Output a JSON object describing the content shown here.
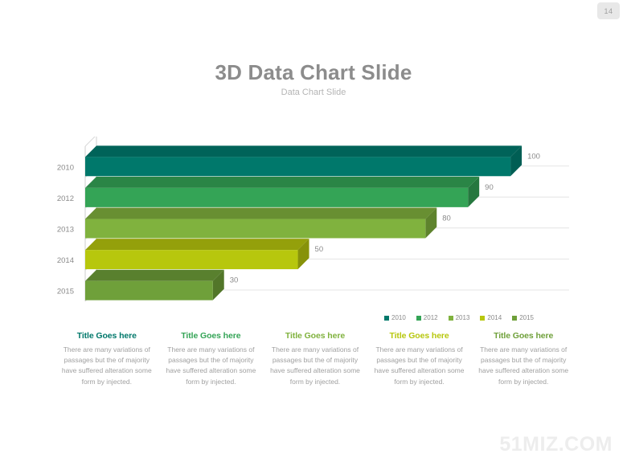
{
  "page": {
    "number": "14"
  },
  "header": {
    "title": "3D Data Chart Slide",
    "subtitle": "Data Chart Slide"
  },
  "watermark": {
    "text": "51MIZ.COM"
  },
  "chart_data": {
    "type": "bar",
    "orientation": "horizontal",
    "style": "3d",
    "title": "3D Data Chart Slide",
    "subtitle": "Data Chart Slide",
    "xlabel": "",
    "ylabel": "",
    "categories": [
      "2010",
      "2012",
      "2013",
      "2014",
      "2015"
    ],
    "values": [
      100,
      90,
      80,
      50,
      30
    ],
    "value_labels": [
      "100",
      "90",
      "80",
      "50",
      "30"
    ],
    "xlim": [
      0,
      110
    ],
    "grid": true,
    "legend_position": "bottom-right",
    "legend": [
      "2010",
      "2012",
      "2013",
      "2014",
      "2015"
    ],
    "series": [
      {
        "name": "2010",
        "value": 100,
        "color": "#00786B",
        "top": "#006359",
        "side": "#005E54"
      },
      {
        "name": "2012",
        "value": 90,
        "color": "#34A456",
        "top": "#2A8546",
        "side": "#26783F"
      },
      {
        "name": "2013",
        "value": 80,
        "color": "#80B23E",
        "top": "#688F32",
        "side": "#5E832D"
      },
      {
        "name": "2014",
        "value": 50,
        "color": "#B7C70D",
        "top": "#94A00B",
        "side": "#87920A"
      },
      {
        "name": "2015",
        "value": 30,
        "color": "#6FA03A",
        "top": "#59802E",
        "side": "#527629"
      }
    ]
  },
  "captions": [
    {
      "title": "Title Goes here",
      "color": "#00786B",
      "body": "There are many variations of passages but the of majority have suffered alteration some form by injected."
    },
    {
      "title": "Title Goes here",
      "color": "#34A456",
      "body": "There are many variations of passages but the of majority have suffered alteration some form by injected."
    },
    {
      "title": "Title Goes here",
      "color": "#80B23E",
      "body": "There are many variations of passages but the of majority have suffered alteration some form by injected."
    },
    {
      "title": "Title Goes here",
      "color": "#B7C70D",
      "body": "There are many variations of passages but the of majority have suffered alteration some form by injected."
    },
    {
      "title": "Title Goes here",
      "color": "#6FA03A",
      "body": "There are many variations of passages but the of majority have suffered alteration some form by injected."
    }
  ]
}
